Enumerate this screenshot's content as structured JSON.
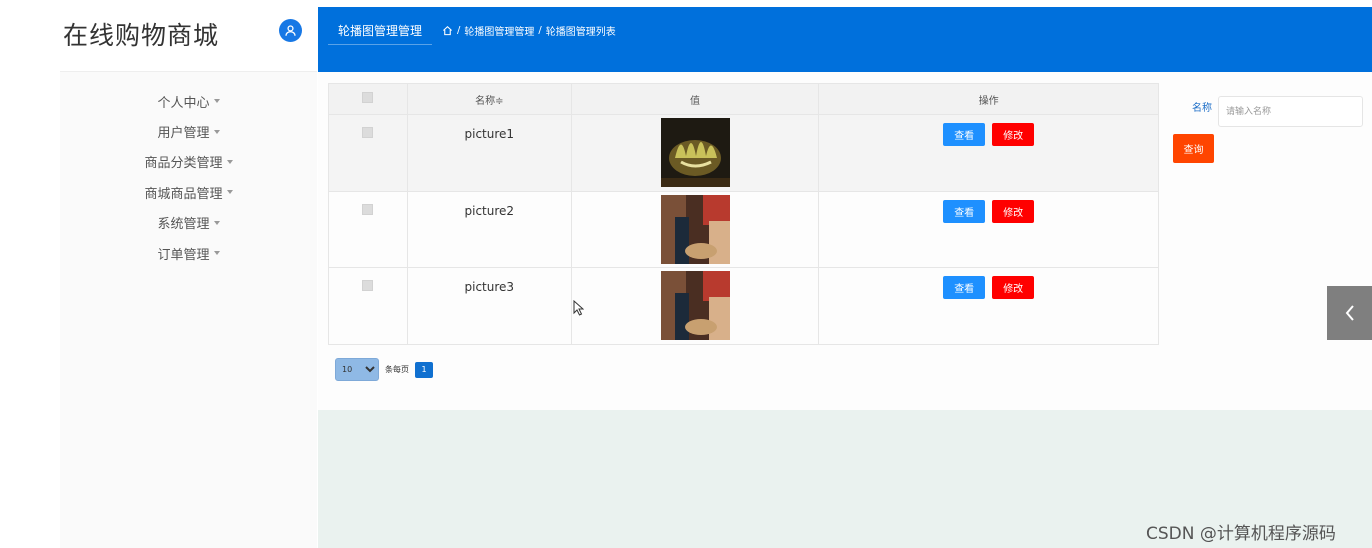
{
  "app": {
    "title": "在线购物商城"
  },
  "sidebar": {
    "items": [
      {
        "label": "个人中心"
      },
      {
        "label": "用户管理"
      },
      {
        "label": "商品分类管理"
      },
      {
        "label": "商城商品管理"
      },
      {
        "label": "系统管理"
      },
      {
        "label": "订单管理"
      }
    ]
  },
  "header": {
    "active_tab": "轮播图管理管理",
    "breadcrumb": {
      "level1": "轮播图管理管理",
      "level2": "轮播图管理列表",
      "separator": "/"
    }
  },
  "table": {
    "columns": {
      "name": "名称",
      "value": "值",
      "actions": "操作"
    },
    "sort_indicator": "≑",
    "rows": [
      {
        "name": "picture1",
        "image": "food-thumbnail",
        "view_label": "查看",
        "edit_label": "修改"
      },
      {
        "name": "picture2",
        "image": "shop-thumbnail",
        "view_label": "查看",
        "edit_label": "修改"
      },
      {
        "name": "picture3",
        "image": "shop-thumbnail",
        "view_label": "查看",
        "edit_label": "修改"
      }
    ]
  },
  "pagination": {
    "page_size": "10",
    "per_page_label": "条每页",
    "current_page": "1"
  },
  "search": {
    "label": "名称",
    "placeholder": "请输入名称",
    "button": "查询"
  },
  "watermark": "CSDN @计算机程序源码",
  "colors": {
    "header": "#0070dc",
    "view_button": "#1e90ff",
    "edit_button": "#ff0000",
    "query_button": "#ff4500"
  }
}
